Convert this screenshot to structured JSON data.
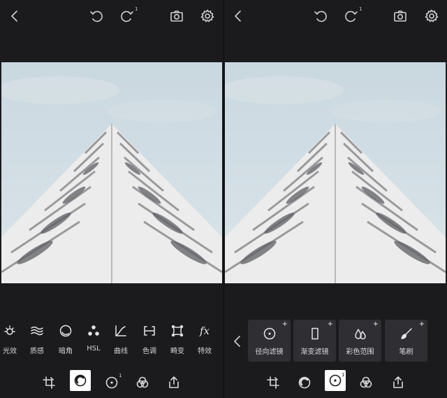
{
  "colors": {
    "background": "#1b1b1d",
    "card": "#2f2f33",
    "active": "#ffffff",
    "sky": "#cfdbe2"
  },
  "icons": {
    "top": [
      "back-icon",
      "undo-icon",
      "redo-icon",
      "camera-icon",
      "settings-icon"
    ],
    "bottom": [
      "crop-icon",
      "tools-icon",
      "selective-icon",
      "filters-icon",
      "share-icon"
    ]
  },
  "left_panel": {
    "redo_badge": "1",
    "tools": [
      {
        "label": "光效",
        "icon": "sun-icon"
      },
      {
        "label": "质感",
        "icon": "waves-icon"
      },
      {
        "label": "暗角",
        "icon": "vignette-icon"
      },
      {
        "label": "HSL",
        "icon": "dots-icon"
      },
      {
        "label": "曲线",
        "icon": "curve-icon"
      },
      {
        "label": "色调",
        "icon": "split-tone-icon"
      },
      {
        "label": "畸变",
        "icon": "distortion-icon"
      },
      {
        "label": "特效",
        "icon": "fx-icon"
      }
    ],
    "fx_glyph": "fx",
    "bottom_selective_badge": "1",
    "active_bottom": "tools"
  },
  "right_panel": {
    "redo_badge": "1",
    "cards": [
      {
        "label": "径向滤镜",
        "icon": "radial-filter-icon",
        "plus": "+"
      },
      {
        "label": "渐变滤镜",
        "icon": "gradient-filter-icon",
        "plus": "+"
      },
      {
        "label": "彩色范围",
        "icon": "color-range-icon",
        "plus": "+"
      },
      {
        "label": "笔刷",
        "icon": "brush-icon",
        "plus": "+"
      }
    ],
    "bottom_selective_badge": "1",
    "active_bottom": "selective"
  }
}
